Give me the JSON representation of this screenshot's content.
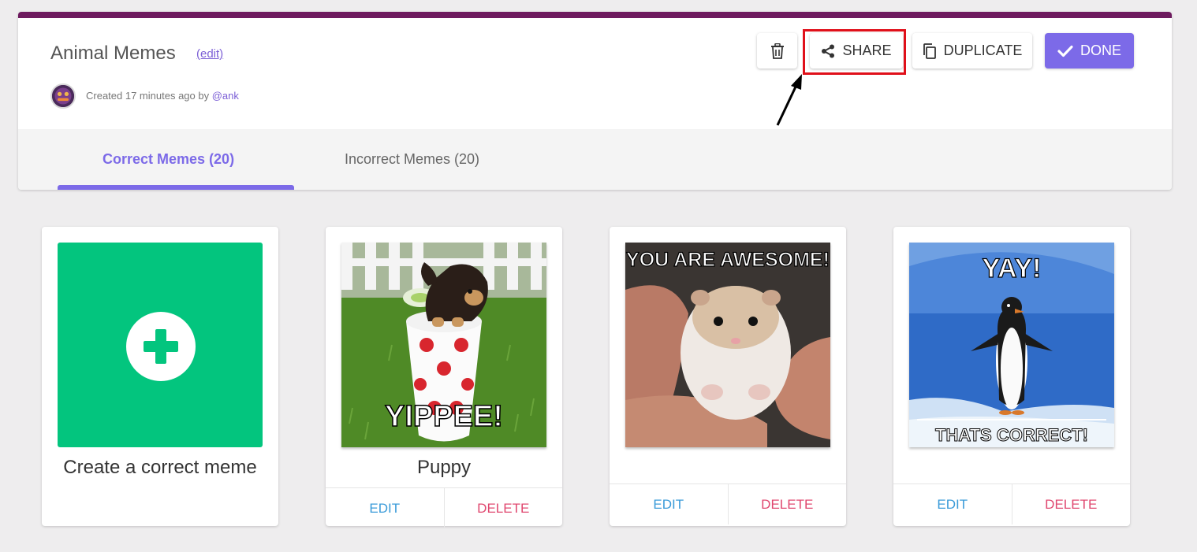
{
  "quiz": {
    "title": "Animal Memes",
    "edit_label": "(edit)",
    "created_prefix": "Created 17 minutes ago by ",
    "created_user": "@ank"
  },
  "toolbar": {
    "trash_icon": "trash-icon",
    "share_label": "SHARE",
    "duplicate_label": "DUPLICATE",
    "done_label": "DONE"
  },
  "tabs": [
    {
      "label": "Correct Memes (20)",
      "active": true
    },
    {
      "label": "Incorrect Memes (20)",
      "active": false
    }
  ],
  "create_card": {
    "label": "Create a correct meme"
  },
  "memes": [
    {
      "top_text": "",
      "bottom_text": "YIPPEE!",
      "caption": "Puppy",
      "edit": "EDIT",
      "delete": "DELETE"
    },
    {
      "top_text": "YOU ARE AWESOME!",
      "bottom_text": "",
      "caption": "",
      "edit": "EDIT",
      "delete": "DELETE"
    },
    {
      "top_text": "YAY!",
      "bottom_text": "THATS CORRECT!",
      "caption": "",
      "edit": "EDIT",
      "delete": "DELETE"
    }
  ],
  "colors": {
    "accent": "#7c6ae8",
    "brand_bar": "#6d1a5e",
    "create_tile": "#03c57e",
    "edit": "#3a9bd9",
    "delete": "#e04870",
    "highlight": "#e0101a"
  }
}
